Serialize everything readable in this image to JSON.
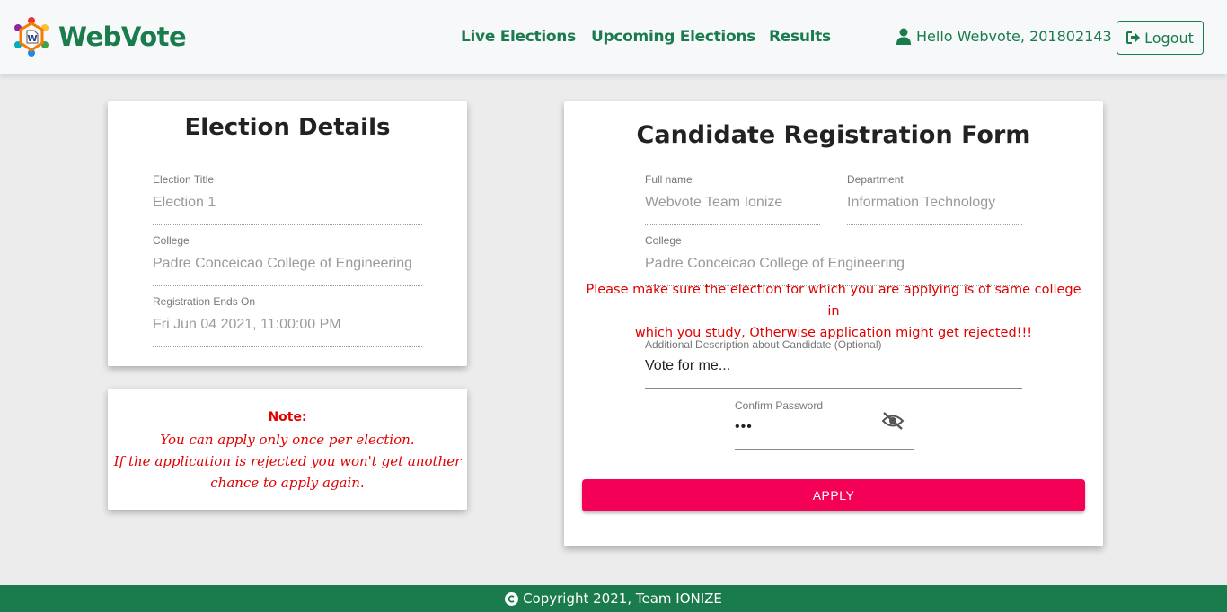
{
  "navbar": {
    "brand": "WebVote",
    "links": [
      "Live Elections",
      "Upcoming Elections",
      "Results"
    ],
    "greeting": "Hello Webvote, 201802143",
    "logout_label": "Logout",
    "colors": {
      "brand": "#1a7b4c",
      "background": "#f7f8fa"
    }
  },
  "election_details": {
    "title": "Election Details",
    "fields": [
      {
        "label": "Election Title",
        "value": "Election 1"
      },
      {
        "label": "College",
        "value": "Padre Conceicao College of Engineering"
      },
      {
        "label": "Registration Ends On",
        "value": "Fri Jun 04 2021, 11:00:00 PM"
      }
    ]
  },
  "note": {
    "title": "Note:",
    "lines": [
      "You can apply only once per election.",
      "If the application is rejected you won't get another",
      "chance to apply again."
    ]
  },
  "registration_form": {
    "title": "Candidate Registration Form",
    "full_name": {
      "label": "Full name",
      "value": "Webvote Team Ionize"
    },
    "department": {
      "label": "Department",
      "value": "Information Technology"
    },
    "college": {
      "label": "College",
      "value": "Padre Conceicao College of Engineering"
    },
    "warning_lines": [
      "Please make sure the election for which you are applying is of same college in",
      "which you study, Otherwise application might get rejected!!!"
    ],
    "description": {
      "label": "Additional Description about Candidate (Optional)",
      "value": "Vote for me..."
    },
    "password": {
      "label": "Confirm Password",
      "value": "•••"
    },
    "apply_label": "APPLY",
    "colors": {
      "apply": "#f50057",
      "warning": "#e00000"
    }
  },
  "footer": {
    "text": "Copyright 2021, Team IONIZE"
  }
}
